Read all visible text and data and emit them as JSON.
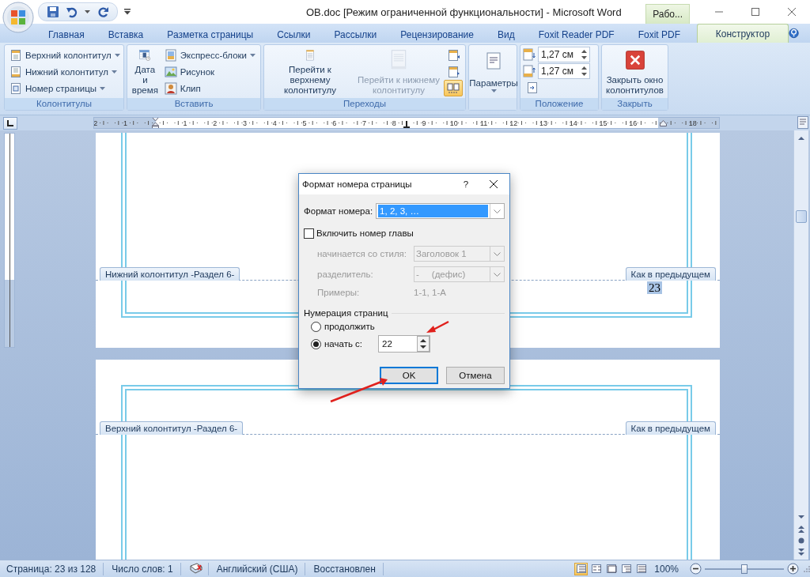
{
  "title_bar": {
    "title": "OB.doc [Режим ограниченной функциональности] - Microsoft Word",
    "context_tab": "Рабо..."
  },
  "tabs": [
    {
      "label": "Главная",
      "selected": false
    },
    {
      "label": "Вставка",
      "selected": false
    },
    {
      "label": "Разметка страницы",
      "selected": false
    },
    {
      "label": "Ссылки",
      "selected": false
    },
    {
      "label": "Рассылки",
      "selected": false
    },
    {
      "label": "Рецензирование",
      "selected": false
    },
    {
      "label": "Вид",
      "selected": false
    },
    {
      "label": "Foxit Reader PDF",
      "selected": false
    },
    {
      "label": "Foxit PDF",
      "selected": false
    },
    {
      "label": "Конструктор",
      "selected": true
    }
  ],
  "ribbon_groups": [
    {
      "label": "Колонтитулы",
      "items": [
        {
          "kind": "small",
          "label": "Верхний колонтитул",
          "dropdown": true,
          "disabled": false
        },
        {
          "kind": "small",
          "label": "Нижний колонтитул",
          "dropdown": true,
          "disabled": false
        },
        {
          "kind": "small",
          "label": "Номер страницы",
          "dropdown": true,
          "disabled": false
        }
      ]
    },
    {
      "label": "Вставить",
      "items": [
        {
          "kind": "large",
          "label": "Дата и время",
          "dropdown": false,
          "disabled": false
        },
        {
          "kind": "small",
          "label": "Экспресс-блоки",
          "dropdown": true,
          "disabled": false
        },
        {
          "kind": "small",
          "label": "Рисунок",
          "dropdown": false,
          "disabled": false
        },
        {
          "kind": "small",
          "label": "Клип",
          "dropdown": false,
          "disabled": false
        }
      ]
    },
    {
      "label": "Переходы",
      "items": [
        {
          "kind": "large",
          "label": "Перейти к верхнему колонтитулу",
          "dropdown": false,
          "disabled": false
        },
        {
          "kind": "large",
          "label": "Перейти к нижнему колонтитулу",
          "dropdown": false,
          "disabled": true
        },
        {
          "kind": "icon",
          "selected": false
        },
        {
          "kind": "icon",
          "selected": false
        },
        {
          "kind": "icon",
          "selected": true
        }
      ]
    },
    {
      "items": [
        {
          "kind": "large",
          "label": "Параметры",
          "dropdown": true,
          "disabled": false
        }
      ]
    },
    {
      "label": "Положение",
      "items": [
        {
          "kind": "spin",
          "value": "1,27 см"
        },
        {
          "kind": "spin",
          "value": "1,27 см"
        },
        {
          "kind": "icon",
          "selected": false
        }
      ]
    },
    {
      "label": "Закрыть",
      "items": [
        {
          "kind": "large",
          "label": "Закрыть окно колонтитулов",
          "dropdown": false,
          "disabled": false
        }
      ]
    }
  ],
  "ruler": {
    "marks": [
      {
        "kind": "number",
        "label": "2"
      },
      {
        "kind": "number",
        "label": "1"
      },
      {
        "kind": "indent"
      },
      {
        "kind": "number",
        "label": "1"
      },
      {
        "kind": "number",
        "label": "2"
      },
      {
        "kind": "number",
        "label": "3"
      },
      {
        "kind": "number",
        "label": "4"
      },
      {
        "kind": "number",
        "label": "5"
      },
      {
        "kind": "number",
        "label": "6"
      },
      {
        "kind": "number",
        "label": "7"
      },
      {
        "kind": "number",
        "label": "8"
      },
      {
        "kind": "number",
        "label": "9"
      },
      {
        "kind": "number",
        "label": "10"
      },
      {
        "kind": "number",
        "label": "11"
      },
      {
        "kind": "number",
        "label": "12"
      },
      {
        "kind": "number",
        "label": "13"
      },
      {
        "kind": "number",
        "label": "14"
      },
      {
        "kind": "number",
        "label": "15"
      },
      {
        "kind": "number",
        "label": "16"
      },
      {
        "kind": "margin"
      },
      {
        "kind": "number",
        "label": "18"
      }
    ]
  },
  "pages": [
    {
      "kind": "footer",
      "section_label": "Нижний колонтитул -Раздел 6-",
      "link_label": "Как в предыдущем",
      "page_number": "23"
    },
    {
      "kind": "header",
      "section_label": "Верхний колонтитул -Раздел 6-",
      "link_label": "Как в предыдущем"
    }
  ],
  "dialog": {
    "title": "Формат номера страницы",
    "help": "?",
    "number_format": {
      "label": "Формат номера:",
      "value": "1, 2, 3, …"
    },
    "include_chapter": {
      "label": "Включить номер главы",
      "checked": false
    },
    "chapter_rows": [
      {
        "kind": "select",
        "label": "начинается со стиля:",
        "value": "Заголовок 1",
        "disabled": true
      },
      {
        "kind": "select",
        "label": "разделитель:",
        "value": "-     (дефис)",
        "disabled": true
      },
      {
        "kind": "text",
        "label": "Примеры:",
        "value": "1-1, 1-A",
        "disabled": true
      }
    ],
    "numbering": {
      "title": "Нумерация страниц",
      "options": [
        {
          "label": "продолжить",
          "selected": false
        },
        {
          "label": "начать с:",
          "selected": true,
          "value": "22"
        }
      ]
    },
    "buttons": [
      {
        "label": "OK",
        "default": true
      },
      {
        "label": "Отмена",
        "default": false
      }
    ]
  },
  "status_bar": {
    "page": "Страница: 23 из 128",
    "words": "Число слов: 1",
    "language": "Английский (США)",
    "doc_state": "Восстановлен",
    "views": [
      {
        "selected": true
      },
      {
        "selected": false
      },
      {
        "selected": false
      },
      {
        "selected": false
      },
      {
        "selected": false
      }
    ],
    "zoom": "100%",
    "zoom_slider": {
      "level": 0.5
    }
  }
}
